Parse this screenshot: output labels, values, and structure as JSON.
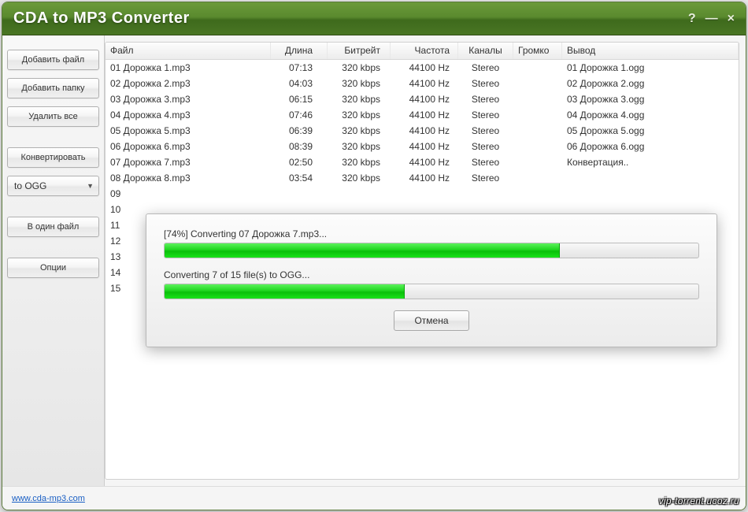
{
  "window": {
    "title": "CDA to MP3 Converter",
    "controls": {
      "help": "?",
      "min": "—",
      "close": "×"
    }
  },
  "sidebar": {
    "add_file": "Добавить файл",
    "add_folder": "Добавить папку",
    "delete_all": "Удалить все",
    "convert": "Конвертировать",
    "format_select": "to OGG",
    "single_file": "В один файл",
    "options": "Опции"
  },
  "columns": {
    "file": "Файл",
    "length": "Длина",
    "bitrate": "Битрейт",
    "freq": "Частота",
    "channels": "Каналы",
    "loud": "Громко",
    "output": "Вывод"
  },
  "rows": [
    {
      "file": "01 Дорожка 1.mp3",
      "len": "07:13",
      "bit": "320 kbps",
      "freq": "44100 Hz",
      "chan": "Stereo",
      "loud": "",
      "out": "01 Дорожка 1.ogg"
    },
    {
      "file": "02 Дорожка 2.mp3",
      "len": "04:03",
      "bit": "320 kbps",
      "freq": "44100 Hz",
      "chan": "Stereo",
      "loud": "",
      "out": "02 Дорожка 2.ogg"
    },
    {
      "file": "03 Дорожка 3.mp3",
      "len": "06:15",
      "bit": "320 kbps",
      "freq": "44100 Hz",
      "chan": "Stereo",
      "loud": "",
      "out": "03 Дорожка 3.ogg"
    },
    {
      "file": "04 Дорожка 4.mp3",
      "len": "07:46",
      "bit": "320 kbps",
      "freq": "44100 Hz",
      "chan": "Stereo",
      "loud": "",
      "out": "04 Дорожка 4.ogg"
    },
    {
      "file": "05 Дорожка 5.mp3",
      "len": "06:39",
      "bit": "320 kbps",
      "freq": "44100 Hz",
      "chan": "Stereo",
      "loud": "",
      "out": "05 Дорожка 5.ogg"
    },
    {
      "file": "06 Дорожка 6.mp3",
      "len": "08:39",
      "bit": "320 kbps",
      "freq": "44100 Hz",
      "chan": "Stereo",
      "loud": "",
      "out": "06 Дорожка 6.ogg"
    },
    {
      "file": "07 Дорожка 7.mp3",
      "len": "02:50",
      "bit": "320 kbps",
      "freq": "44100 Hz",
      "chan": "Stereo",
      "loud": "",
      "out": "Конвертация.."
    },
    {
      "file": "08 Дорожка 8.mp3",
      "len": "03:54",
      "bit": "320 kbps",
      "freq": "44100 Hz",
      "chan": "Stereo",
      "loud": "",
      "out": ""
    },
    {
      "file": "09 ",
      "len": "",
      "bit": "",
      "freq": "",
      "chan": "",
      "loud": "",
      "out": ""
    },
    {
      "file": "10 ",
      "len": "",
      "bit": "",
      "freq": "",
      "chan": "",
      "loud": "",
      "out": ""
    },
    {
      "file": "11 ",
      "len": "",
      "bit": "",
      "freq": "",
      "chan": "",
      "loud": "",
      "out": ""
    },
    {
      "file": "12 ",
      "len": "",
      "bit": "",
      "freq": "",
      "chan": "",
      "loud": "",
      "out": ""
    },
    {
      "file": "13 ",
      "len": "",
      "bit": "",
      "freq": "",
      "chan": "",
      "loud": "",
      "out": ""
    },
    {
      "file": "14 ",
      "len": "",
      "bit": "",
      "freq": "",
      "chan": "",
      "loud": "",
      "out": ""
    },
    {
      "file": "15 ",
      "len": "",
      "bit": "",
      "freq": "",
      "chan": "",
      "loud": "",
      "out": ""
    }
  ],
  "progress": {
    "file_label": "[74%] Converting 07 Дорожка 7.mp3...",
    "file_pct": 74,
    "total_label": "Converting 7 of 15 file(s) to OGG...",
    "total_pct": 45,
    "cancel": "Отмена"
  },
  "footer": {
    "link": "www.cda-mp3.com"
  },
  "watermark": "vip-torrent.ucoz.ru"
}
